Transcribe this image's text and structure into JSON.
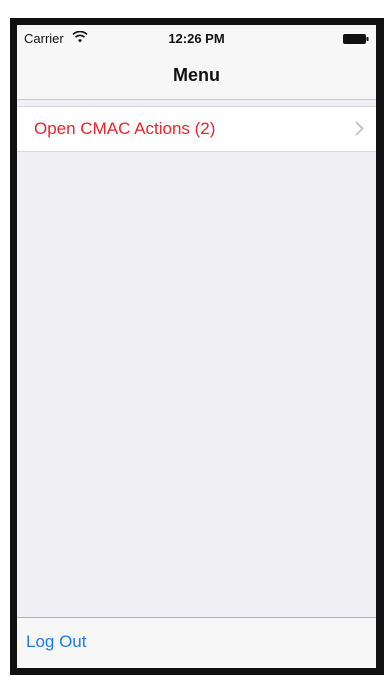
{
  "status_bar": {
    "carrier": "Carrier",
    "wifi_icon": "wifi-icon",
    "time": "12:26 PM",
    "battery_icon": "battery-icon"
  },
  "nav": {
    "title": "Menu"
  },
  "menu": {
    "items": [
      {
        "label": "Open CMAC Actions (2)",
        "icon": "chevron-right-icon",
        "color": "#e8262d"
      }
    ]
  },
  "toolbar": {
    "logout_label": "Log Out",
    "accent": "#1b7cf2"
  }
}
